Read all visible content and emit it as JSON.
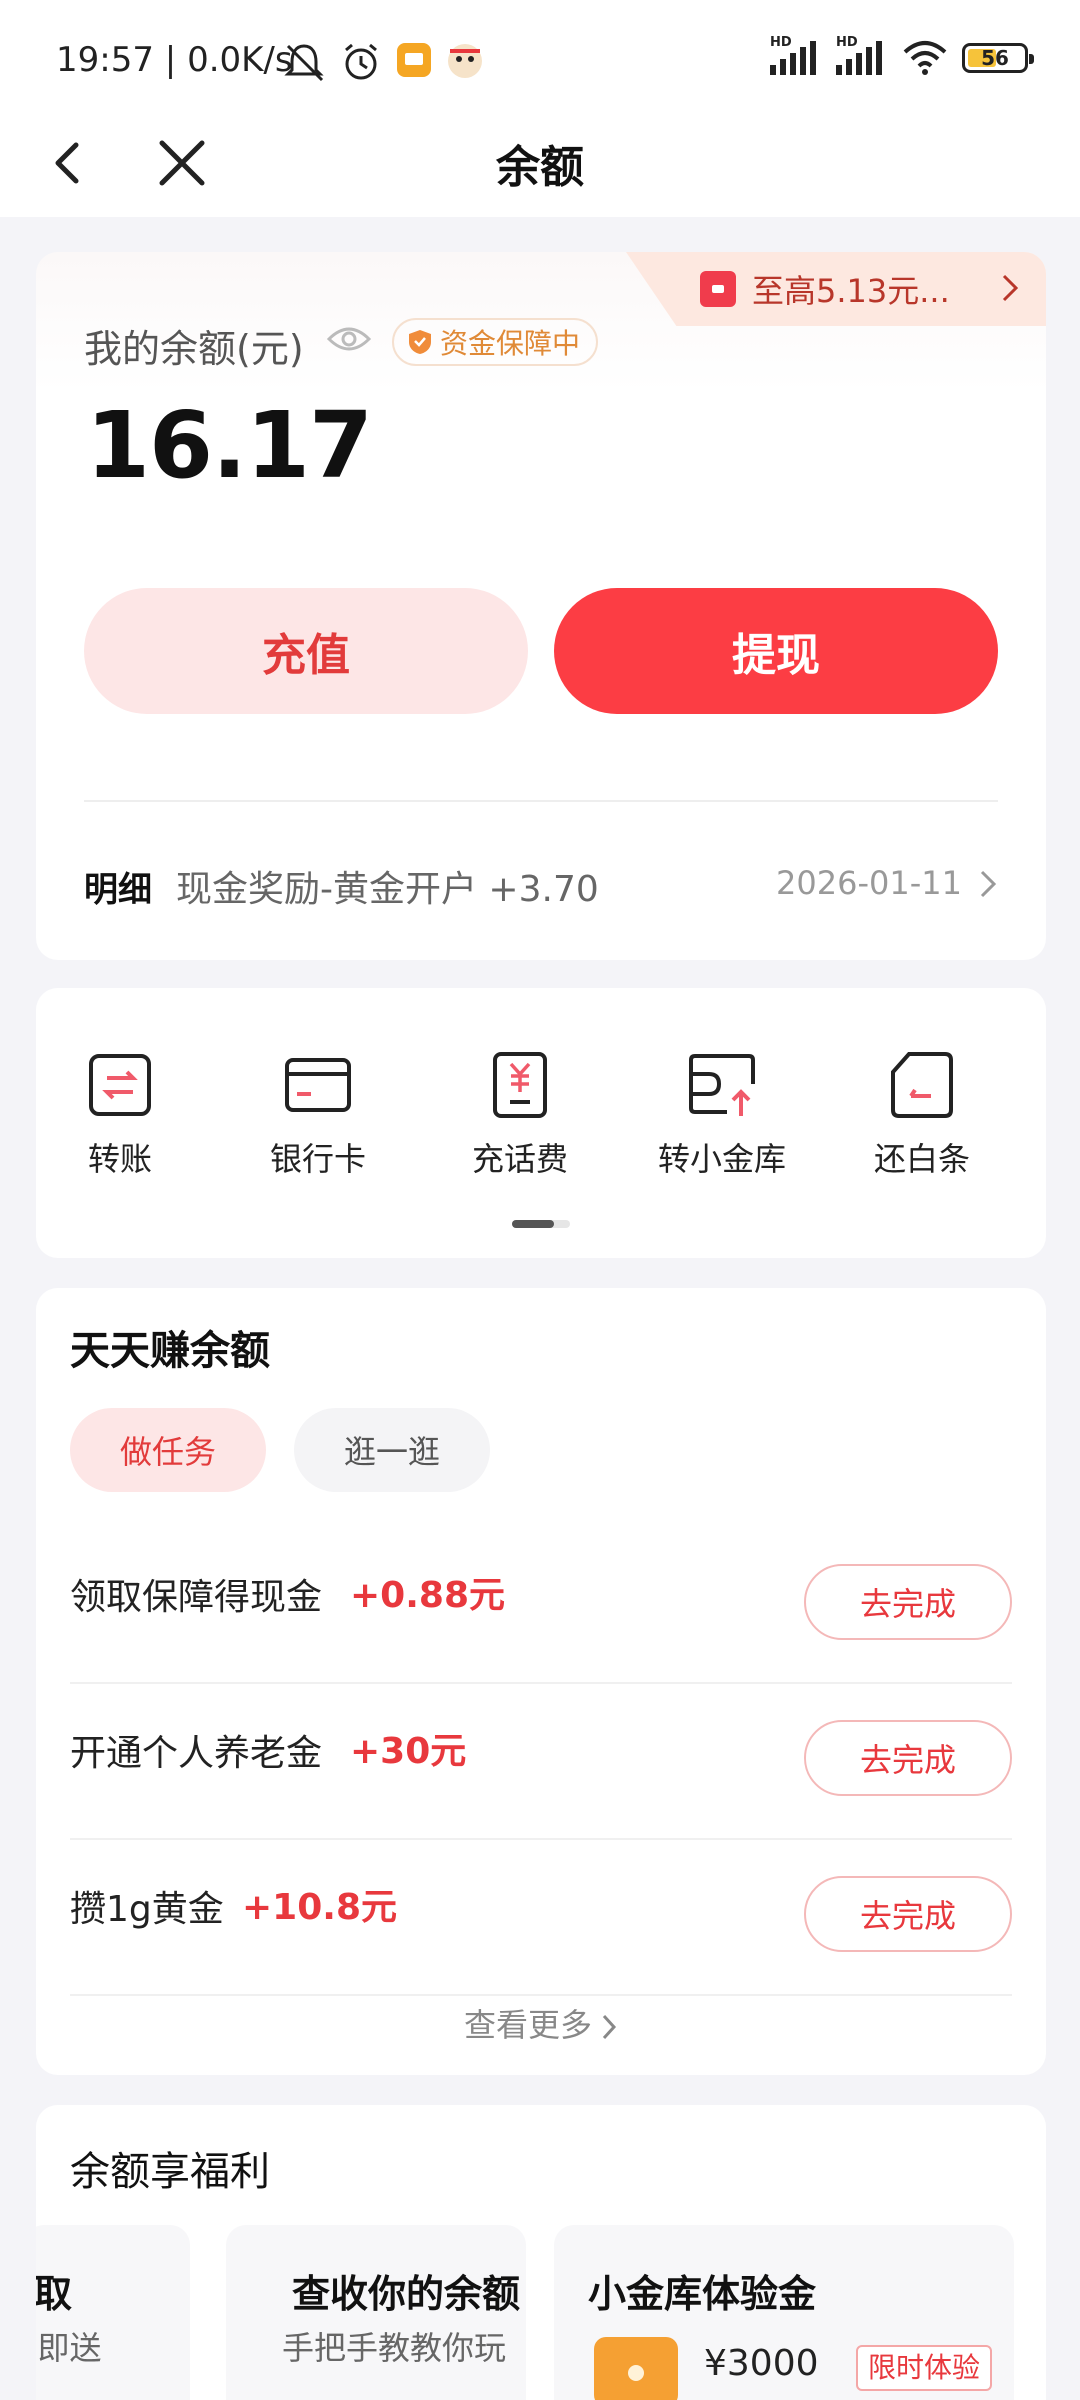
{
  "status_bar": {
    "time": "19:57",
    "net_speed": "0.0K/s",
    "hd1": "HD",
    "hd2": "HD",
    "battery": "56"
  },
  "nav": {
    "title": "余额",
    "back_icon": "back-arrow-icon",
    "close_icon": "close-icon"
  },
  "balance": {
    "promo_text": "至高5.13元...",
    "label": "我的余额(元)",
    "safe_badge": "资金保障中",
    "amount": "16.17",
    "recharge_label": "充值",
    "withdraw_label": "提现",
    "detail_label": "明细",
    "detail_text": "现金奖励-黄金开户 +3.70",
    "detail_date": "2026-01-11"
  },
  "actions": [
    {
      "label": "转账",
      "icon": "transfer-icon"
    },
    {
      "label": "银行卡",
      "icon": "bank-card-icon"
    },
    {
      "label": "充话费",
      "icon": "phone-bill-icon"
    },
    {
      "label": "转小金库",
      "icon": "vault-transfer-icon"
    },
    {
      "label": "还白条",
      "icon": "repay-icon"
    }
  ],
  "earn": {
    "title": "天天赚余额",
    "tab_task": "做任务",
    "tab_browse": "逛一逛",
    "tasks": [
      {
        "name": "领取保障得现金",
        "reward": "+0.88元",
        "button": "去完成"
      },
      {
        "name": "开通个人养老金",
        "reward": "+30元",
        "button": "去完成"
      },
      {
        "name": "攒1g黄金",
        "reward": "+10.8元",
        "button": "去完成"
      }
    ],
    "more": "查看更多"
  },
  "benefits": {
    "title": "余额享福利",
    "card1_title": "取",
    "card1_sub": "-即送",
    "card2_title": "查收你的余额",
    "card2_sub": "手把手教教你玩",
    "card3_title": "小金库体验金",
    "card3_amount": "¥3000",
    "card3_tag": "限时体验"
  },
  "colors": {
    "brand_red": "#fc3d44",
    "reward_red": "#e8383d",
    "light_pink": "#fde6e6",
    "safe_orange": "#e08a37"
  }
}
